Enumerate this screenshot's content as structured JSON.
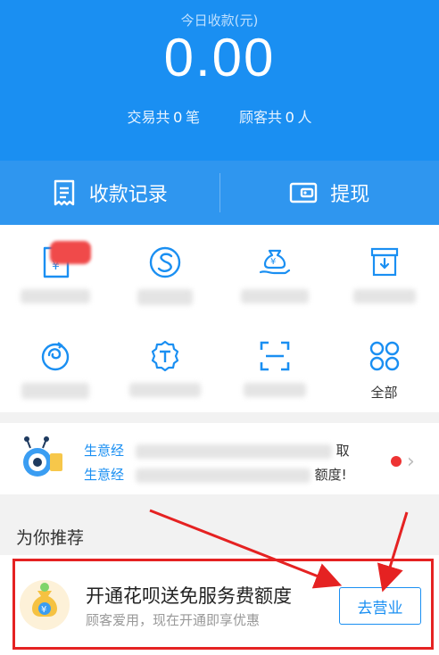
{
  "header": {
    "label": "今日收款(元)",
    "amount": "0.00",
    "trade_prefix": "交易共",
    "trade_count": "0",
    "trade_unit": "笔",
    "customer_prefix": "顾客共",
    "customer_count": "0",
    "customer_unit": "人"
  },
  "actions": {
    "records_label": "收款记录",
    "withdraw_label": "提现"
  },
  "grid": {
    "all_label": "全部"
  },
  "notice": {
    "line1_prefix": "生意经",
    "line1_end": "取",
    "line2_prefix": "生意经",
    "line2_end": "额度!"
  },
  "recommend": {
    "title": "为你推荐",
    "name": "开通花呗送免服务费额度",
    "subtitle": "顾客爱用，现在开通即享优惠",
    "button": "去营业"
  },
  "colors": {
    "primary": "#1a8ff2",
    "action_bar": "#2f96ef",
    "highlight": "#e52222"
  }
}
